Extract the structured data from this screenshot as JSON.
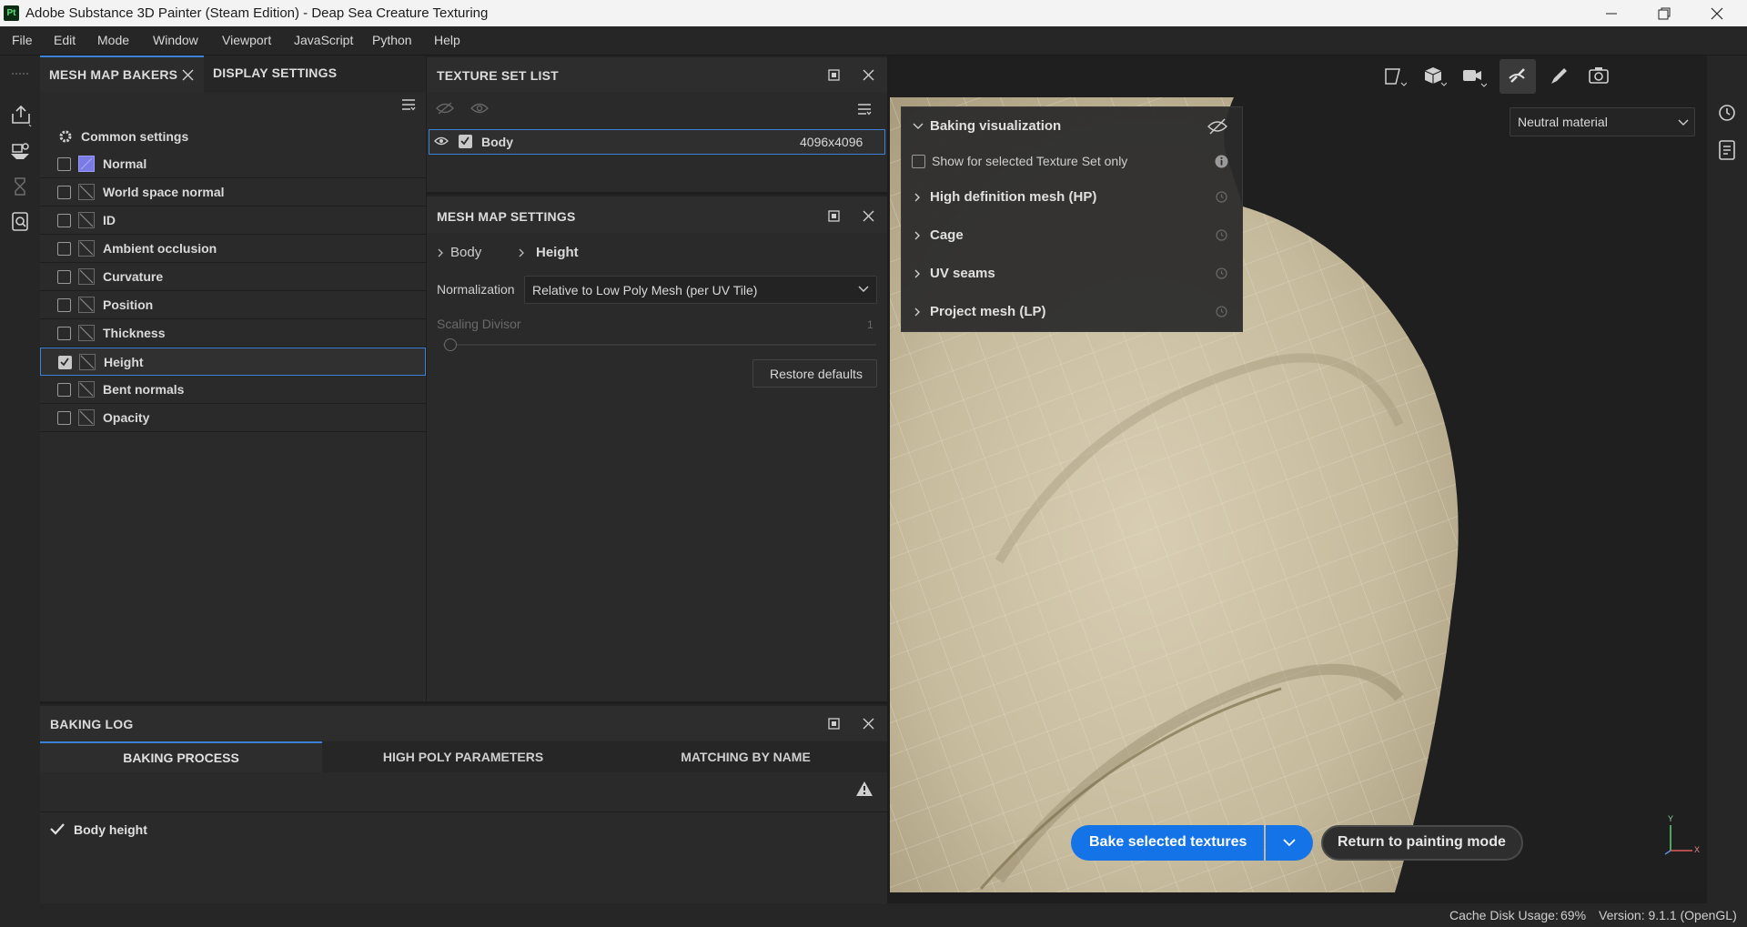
{
  "window": {
    "title": "Adobe Substance 3D Painter (Steam Edition) - Deap Sea Creature Texturing",
    "app_icon_text": "Pt"
  },
  "menu": [
    "File",
    "Edit",
    "Mode",
    "Window",
    "Viewport",
    "JavaScript",
    "Python",
    "Help"
  ],
  "bakers_panel": {
    "tabs": [
      "MESH MAP BAKERS",
      "DISPLAY SETTINGS"
    ],
    "common_settings": "Common settings",
    "maps": [
      {
        "label": "Normal",
        "checked": false
      },
      {
        "label": "World space normal",
        "checked": false
      },
      {
        "label": "ID",
        "checked": false
      },
      {
        "label": "Ambient occlusion",
        "checked": false
      },
      {
        "label": "Curvature",
        "checked": false
      },
      {
        "label": "Position",
        "checked": false
      },
      {
        "label": "Thickness",
        "checked": false
      },
      {
        "label": "Height",
        "checked": true
      },
      {
        "label": "Bent normals",
        "checked": false
      },
      {
        "label": "Opacity",
        "checked": false
      }
    ]
  },
  "texture_set_list": {
    "title": "TEXTURE SET LIST",
    "item_name": "Body",
    "item_resolution": "4096x4096"
  },
  "mesh_map_settings": {
    "title": "MESH MAP SETTINGS",
    "breadcrumb": [
      "Body",
      "Height"
    ],
    "normalization_label": "Normalization",
    "normalization_value": "Relative to Low Poly Mesh (per UV Tile)",
    "scaling_label": "Scaling Divisor",
    "scaling_value": "1",
    "restore_label": "Restore defaults"
  },
  "baking_log": {
    "title": "BAKING LOG",
    "tabs": [
      "BAKING PROCESS",
      "HIGH POLY PARAMETERS",
      "MATCHING BY NAME"
    ],
    "entry": "Body height"
  },
  "viewport": {
    "material_select": "Neutral material",
    "baking_visualization": {
      "title": "Baking visualization",
      "checkbox_label": "Show for selected Texture Set only",
      "sections": [
        "High definition mesh (HP)",
        "Cage",
        "UV seams",
        "Project mesh (LP)"
      ]
    },
    "bake_button": "Bake selected textures",
    "return_button": "Return to painting mode",
    "axis_y": "Y",
    "axis_x": "X"
  },
  "status": {
    "cache_label": "Cache Disk Usage:",
    "cache_value": "69%",
    "version": "Version: 9.1.1 (OpenGL)"
  },
  "colors": {
    "accent": "#3b82d6",
    "bake_button": "#1473e6",
    "panel_bg": "#2b2b2b",
    "mesh": "#c8bc9e"
  }
}
